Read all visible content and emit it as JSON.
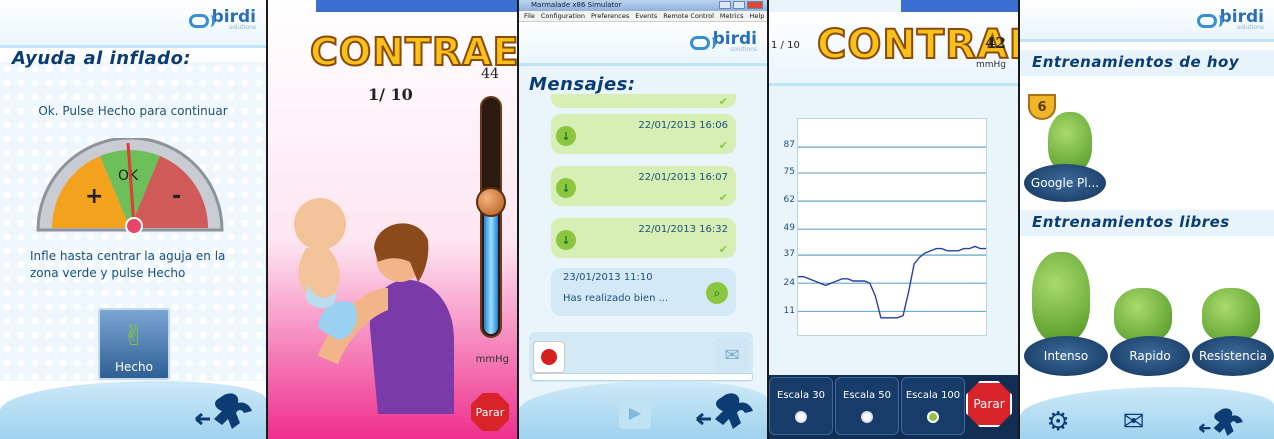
{
  "brand": {
    "name": "birdi",
    "tagline": "solutions"
  },
  "screen1": {
    "title": "Ayuda al inflado:",
    "instruction": "Ok. Pulse Hecho para continuar",
    "gauge": {
      "plus": "+",
      "ok": "OK",
      "minus": "-"
    },
    "hint": "Infle hasta centrar la aguja en la zona verde y pulse Hecho",
    "done_button": "Hecho",
    "back_icon": "runner-back-icon"
  },
  "screen2": {
    "header": "CONTRAE",
    "counter": "1/ 10",
    "pressure": "44",
    "pressure_level": 0.55,
    "unit": "mmHg",
    "stop_button": "Parar"
  },
  "screen3": {
    "window_title": "Marmalade x86 Simulator",
    "menu": [
      "File",
      "Configuration",
      "Preferences",
      "Events",
      "Remote Control",
      "Metrics",
      "Help"
    ],
    "title": "Mensajes:",
    "messages": [
      {
        "date": "22/01/2013 16:06"
      },
      {
        "date": "22/01/2013 16:07"
      },
      {
        "date": "22/01/2013 16:32"
      }
    ],
    "last_message": {
      "date": "23/01/2013 11:10",
      "text": "Has realizado bien ..."
    }
  },
  "screen4": {
    "header": "CONTRAE",
    "counter": "1 / 10",
    "pressure": "42",
    "unit": "mmHg",
    "scales": [
      {
        "label": "Escala 30",
        "selected": false
      },
      {
        "label": "Escala 50",
        "selected": false
      },
      {
        "label": "Escala 100",
        "selected": true
      }
    ],
    "stop_button": "Parar"
  },
  "chart_data": {
    "type": "line",
    "y_ticks": [
      "87",
      "75",
      "62",
      "49",
      "37",
      "24",
      "11"
    ],
    "ylim": [
      0,
      100
    ],
    "series": [
      {
        "values": [
          27,
          27,
          26,
          25,
          24,
          23,
          24,
          25,
          26,
          26,
          25,
          25,
          25,
          24,
          18,
          8,
          8,
          8,
          8,
          9,
          20,
          33,
          36,
          38,
          39,
          40,
          40,
          39,
          39,
          39,
          40,
          40,
          41,
          40,
          40
        ]
      }
    ]
  },
  "screen5": {
    "today_title": "Entrenamientos de hoy",
    "trophy_number": "6",
    "today_item": "Google Pl...",
    "free_title": "Entrenamientos libres",
    "free_items": [
      "Intenso",
      "Rapido",
      "Resistencia"
    ]
  },
  "colors": {
    "accent": "#0c3c74",
    "green": "#8cc63e",
    "red": "#d8232a",
    "navy": "#122e52"
  }
}
